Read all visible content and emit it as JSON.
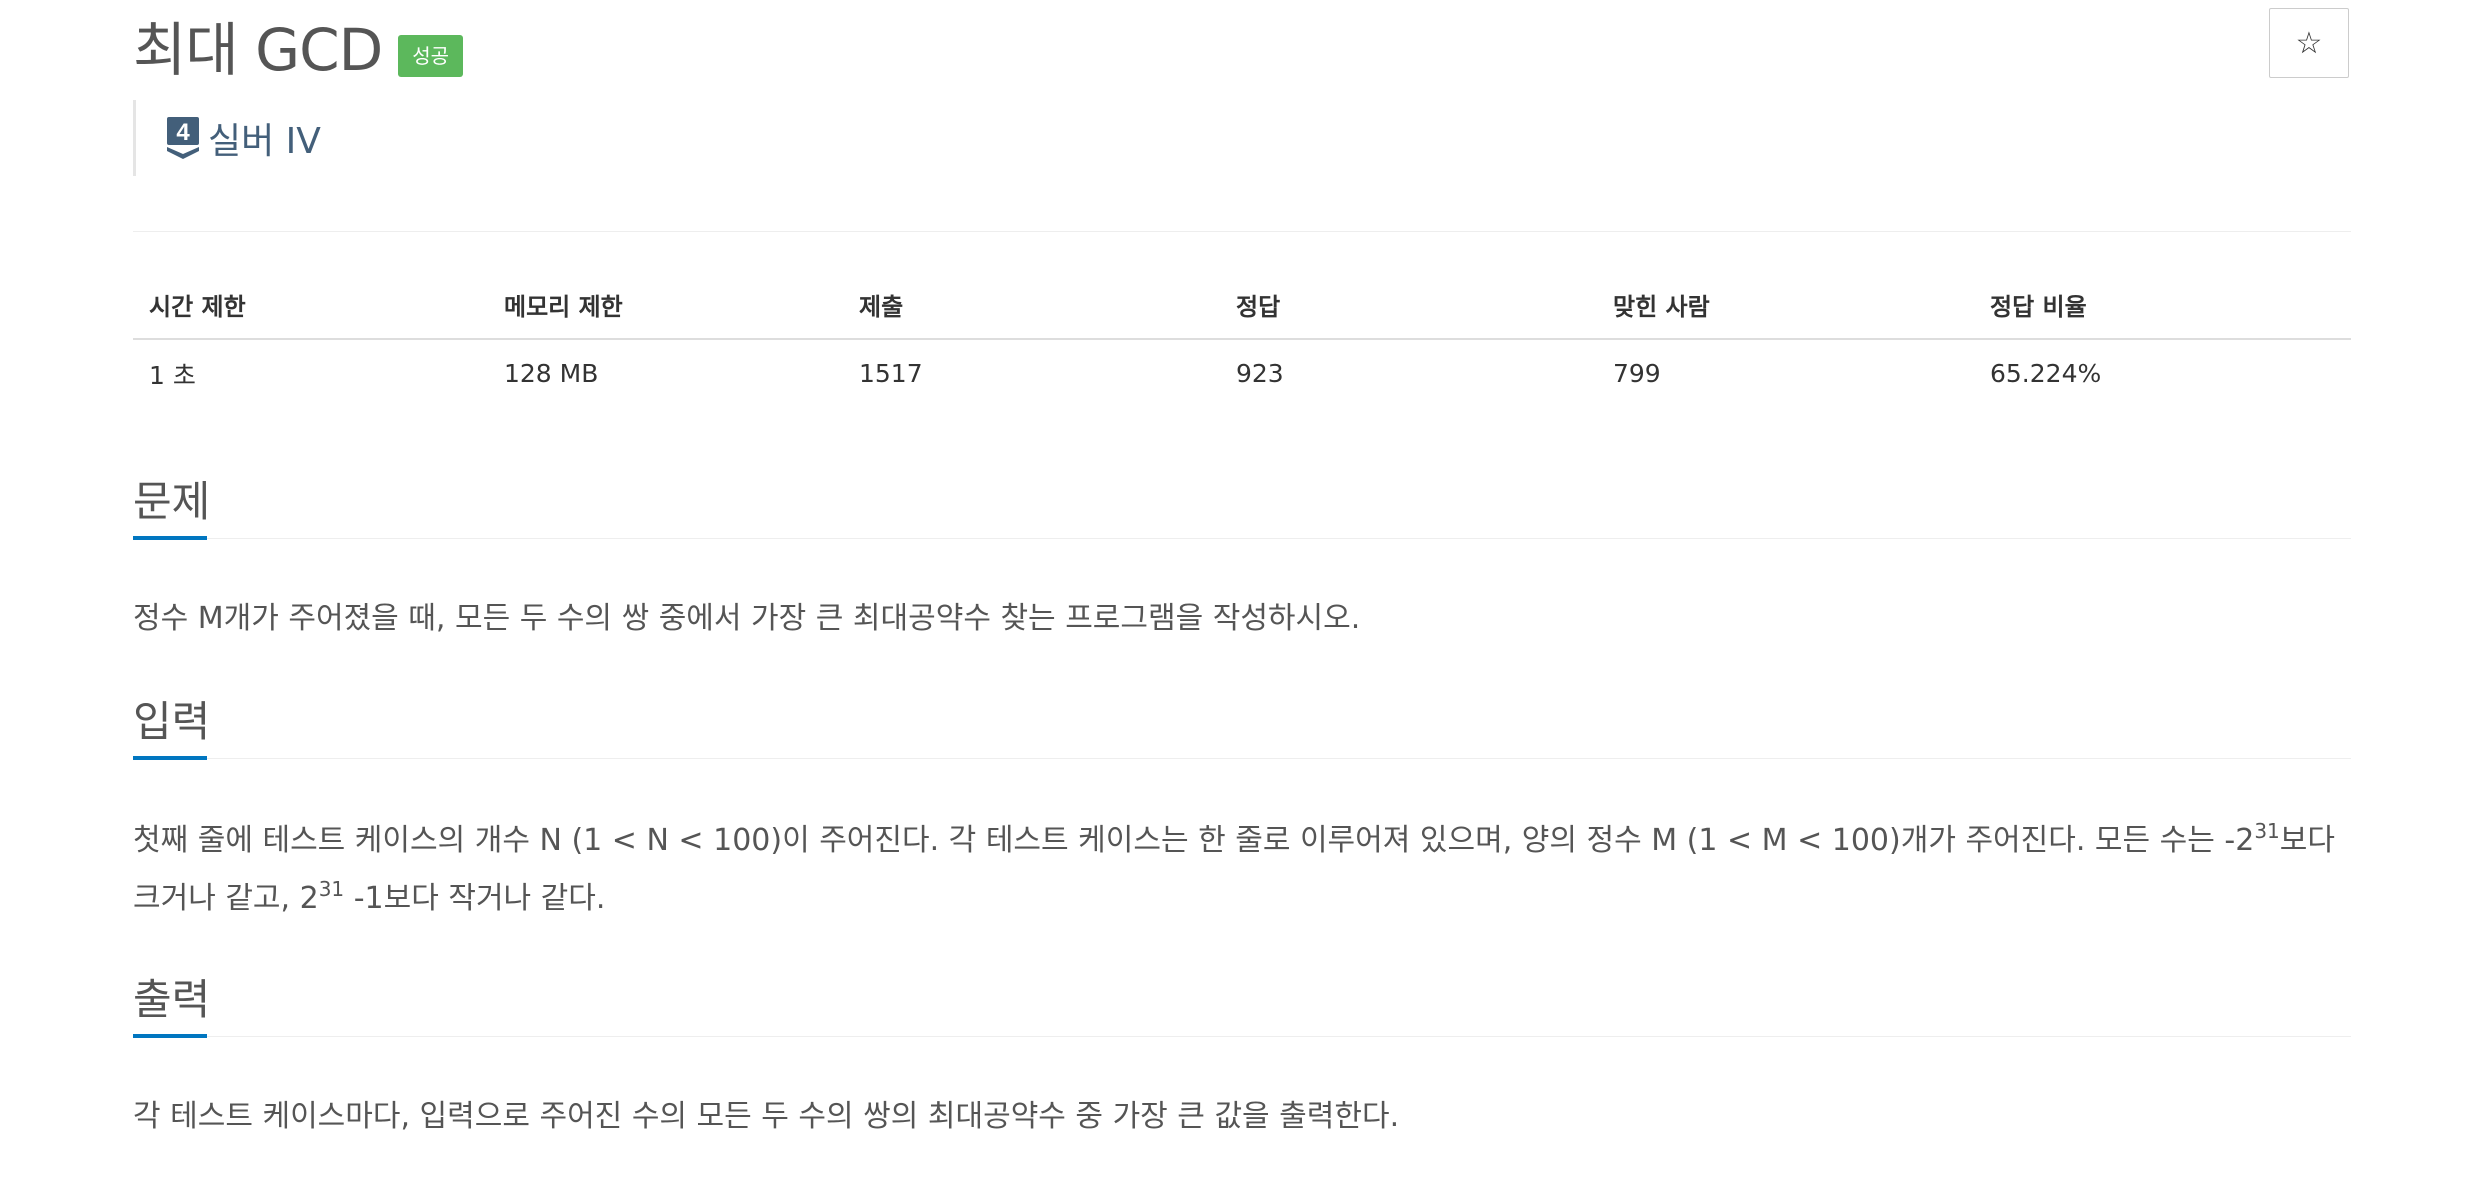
{
  "problem": {
    "title": "최대 GCD",
    "status_badge": "성공",
    "star_glyph": "☆",
    "tier": {
      "number": "4",
      "label": "실버 IV",
      "color": "#435f7a"
    }
  },
  "info_table": {
    "headers": [
      "시간 제한",
      "메모리 제한",
      "제출",
      "정답",
      "맞힌 사람",
      "정답 비율"
    ],
    "values": [
      "1 초",
      "128 MB",
      "1517",
      "923",
      "799",
      "65.224%"
    ]
  },
  "sections": {
    "problem": {
      "heading": "문제",
      "text": "정수 M개가 주어졌을 때, 모든 두 수의 쌍 중에서 가장 큰 최대공약수 찾는 프로그램을 작성하시오."
    },
    "input": {
      "heading": "입력",
      "text_1": "첫째 줄에 테스트 케이스의 개수 N (1 < N < 100)이 주어진다. 각 테스트 케이스는 한 줄로 이루어져 있으며, 양의 정수 M (1 < M < 100)개가 주어진다. 모든 수는 -2",
      "sup_1": "31",
      "text_2": "보다 크거나 같고, 2",
      "sup_2": "31",
      "text_3": " -1보다 작거나 같다."
    },
    "output": {
      "heading": "출력",
      "text": "각 테스트 케이스마다, 입력으로 주어진 수의 모든 두 수의 쌍의 최대공약수 중 가장 큰 값을 출력한다."
    }
  },
  "colors": {
    "accent_blue": "#0076c0",
    "success_green": "#5cb85c",
    "tier_silver": "#435f7a"
  }
}
